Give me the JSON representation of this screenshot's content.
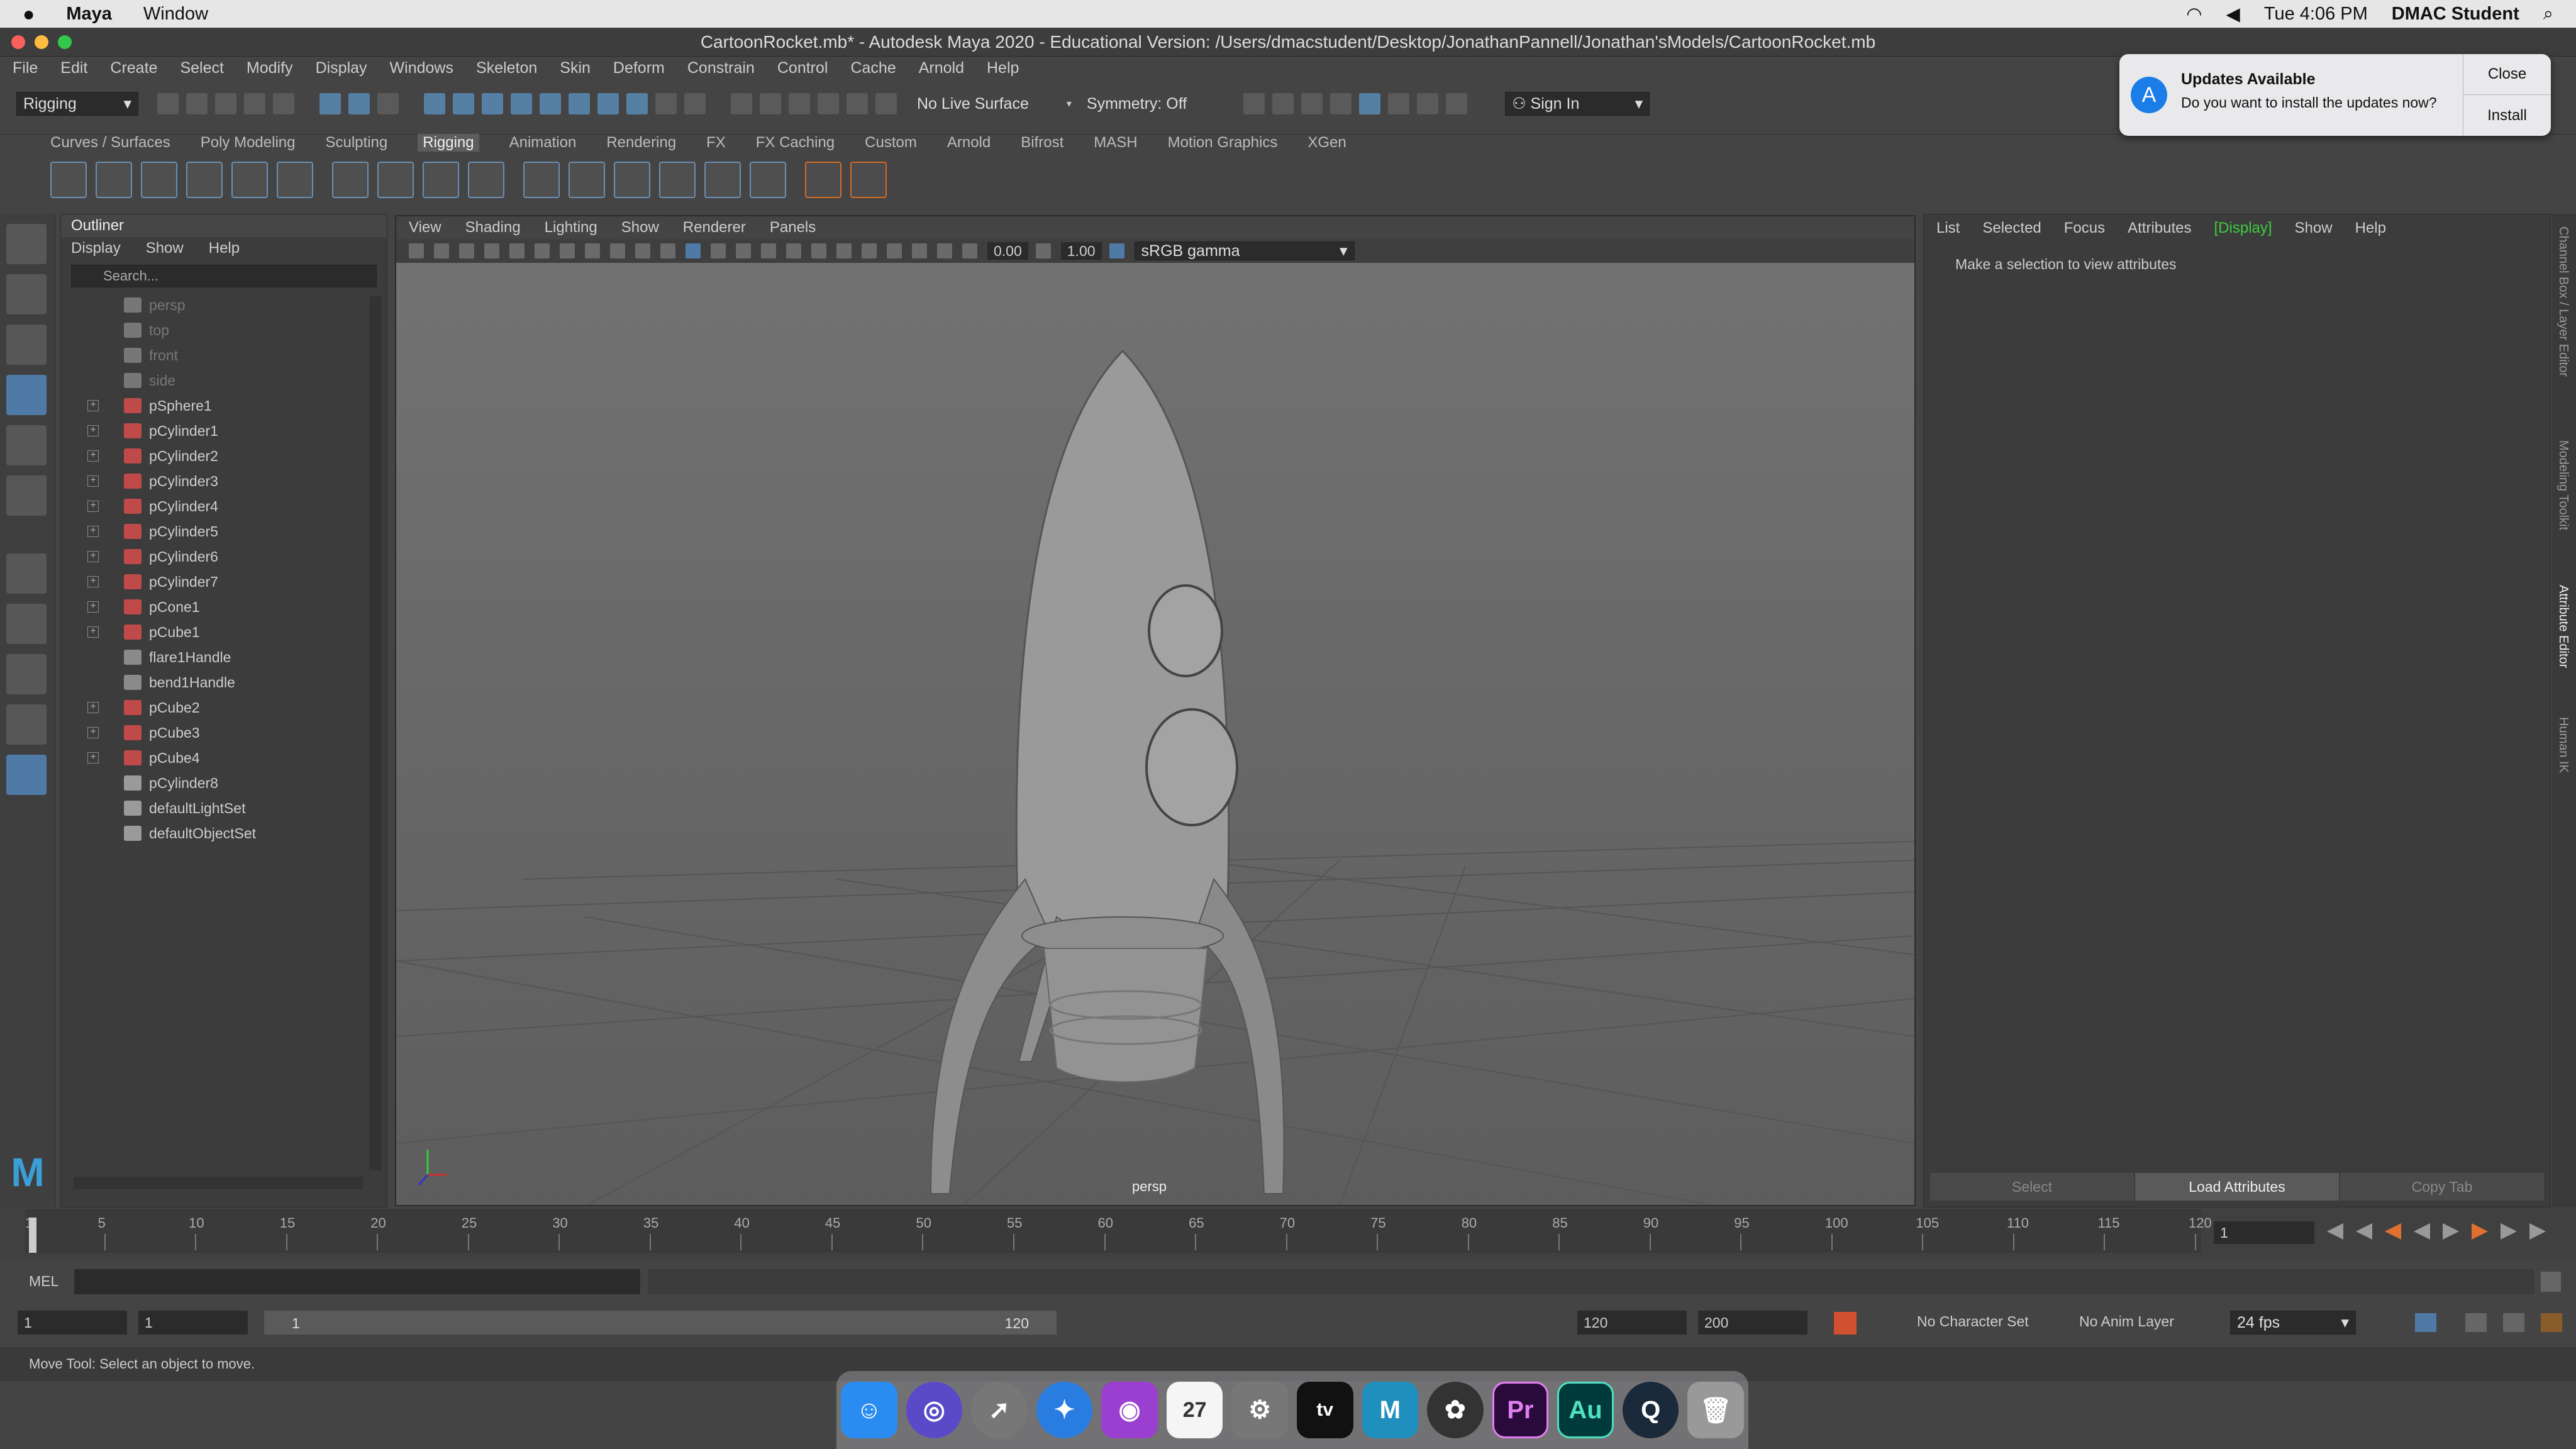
{
  "mac_menubar": {
    "app": "Maya",
    "items": [
      "Window"
    ],
    "clock": "Tue 4:06 PM",
    "user": "DMAC Student"
  },
  "window_title": "CartoonRocket.mb* - Autodesk Maya 2020 - Educational Version: /Users/dmacstudent/Desktop/JonathanPannell/Jonathan'sModels/CartoonRocket.mb",
  "maya_menu": [
    "File",
    "Edit",
    "Create",
    "Select",
    "Modify",
    "Display",
    "Windows",
    "Skeleton",
    "Skin",
    "Deform",
    "Constrain",
    "Control",
    "Cache",
    "Arnold",
    "Help"
  ],
  "status_line": {
    "menuset": "Rigging",
    "live_surface": "No Live Surface",
    "symmetry": "Symmetry: Off",
    "sign_in": "Sign In"
  },
  "shelf_tabs": [
    "Curves / Surfaces",
    "Poly Modeling",
    "Sculpting",
    "Rigging",
    "Animation",
    "Rendering",
    "FX",
    "FX Caching",
    "Custom",
    "Arnold",
    "Bifrost",
    "MASH",
    "Motion Graphics",
    "XGen"
  ],
  "shelf_active": "Rigging",
  "notification": {
    "title": "Updates Available",
    "body": "Do you want to install the updates now?",
    "close": "Close",
    "install": "Install"
  },
  "outliner": {
    "title": "Outliner",
    "menu": [
      "Display",
      "Show",
      "Help"
    ],
    "search_placeholder": "Search...",
    "items": [
      {
        "name": "persp",
        "type": "camera",
        "dim": true
      },
      {
        "name": "top",
        "type": "camera",
        "dim": true
      },
      {
        "name": "front",
        "type": "camera",
        "dim": true
      },
      {
        "name": "side",
        "type": "camera",
        "dim": true
      },
      {
        "name": "pSphere1",
        "type": "mesh",
        "exp": true
      },
      {
        "name": "pCylinder1",
        "type": "mesh",
        "exp": true
      },
      {
        "name": "pCylinder2",
        "type": "mesh",
        "exp": true
      },
      {
        "name": "pCylinder3",
        "type": "mesh",
        "exp": true
      },
      {
        "name": "pCylinder4",
        "type": "mesh",
        "exp": true
      },
      {
        "name": "pCylinder5",
        "type": "mesh",
        "exp": true
      },
      {
        "name": "pCylinder6",
        "type": "mesh",
        "exp": true
      },
      {
        "name": "pCylinder7",
        "type": "mesh",
        "exp": true
      },
      {
        "name": "pCone1",
        "type": "mesh",
        "exp": true
      },
      {
        "name": "pCube1",
        "type": "mesh",
        "exp": true
      },
      {
        "name": "flare1Handle",
        "type": "deformer"
      },
      {
        "name": "bend1Handle",
        "type": "deformer"
      },
      {
        "name": "pCube2",
        "type": "mesh",
        "exp": true
      },
      {
        "name": "pCube3",
        "type": "mesh",
        "exp": true
      },
      {
        "name": "pCube4",
        "type": "mesh",
        "exp": true
      },
      {
        "name": "pCylinder8",
        "type": "group"
      },
      {
        "name": "defaultLightSet",
        "type": "set"
      },
      {
        "name": "defaultObjectSet",
        "type": "set"
      }
    ]
  },
  "viewport": {
    "menu": [
      "View",
      "Shading",
      "Lighting",
      "Show",
      "Renderer",
      "Panels"
    ],
    "exposure": "0.00",
    "gamma": "1.00",
    "colorspace": "sRGB gamma",
    "camera_label": "persp"
  },
  "attribute_editor": {
    "menu": [
      "List",
      "Selected",
      "Focus",
      "Attributes",
      "[Display]",
      "Show",
      "Help"
    ],
    "message": "Make a selection to view attributes",
    "buttons": [
      "Select",
      "Load Attributes",
      "Copy Tab"
    ]
  },
  "side_tabs": [
    "Channel Box / Layer Editor",
    "Modeling Toolkit",
    "Attribute Editor",
    "Human IK"
  ],
  "time_slider": {
    "ticks": [
      "1",
      "5",
      "10",
      "15",
      "20",
      "25",
      "30",
      "35",
      "40",
      "45",
      "50",
      "55",
      "60",
      "65",
      "70",
      "75",
      "80",
      "85",
      "90",
      "95",
      "100",
      "105",
      "110",
      "115",
      "120"
    ],
    "current_frame": "1"
  },
  "command_line": {
    "lang": "MEL"
  },
  "range": {
    "start": "1",
    "playback_start": "1",
    "slider_start": "1",
    "slider_end": "120",
    "playback_end": "120",
    "end": "200",
    "character_set": "No Character Set",
    "anim_layer": "No Anim Layer",
    "fps": "24 fps"
  },
  "help_line": "Move Tool: Select an object to move.",
  "dock_apps": [
    "Finder",
    "Siri",
    "Launchpad",
    "Safari",
    "Podcasts",
    "Calendar",
    "System Preferences",
    "TV",
    "Maya",
    "DaVinci Resolve",
    "Premiere Pro",
    "Audition",
    "QuickTime",
    "Trash"
  ]
}
